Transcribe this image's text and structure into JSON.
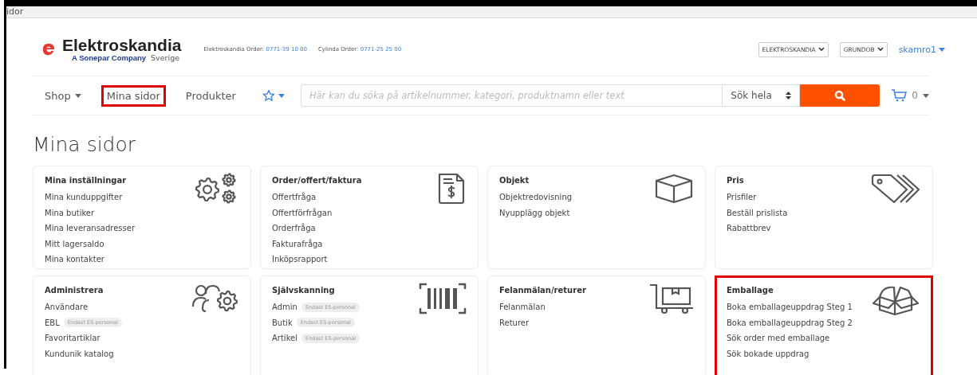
{
  "window": {
    "title": "idor"
  },
  "header": {
    "brand": "Elektroskandia",
    "tagline": "A Sonepar Company",
    "country": "Sverige",
    "contacts": [
      {
        "label": "Elektroskandia Order:",
        "phone": "0771-39 10 00"
      },
      {
        "label": "Cylinda Order:",
        "phone": "0771-25 25 00"
      }
    ],
    "selects": [
      "ELEKTROSKANDIA",
      "GRUNDOB"
    ],
    "user": "skamro1"
  },
  "nav": {
    "items": [
      {
        "label": "Shop",
        "dropdown": true,
        "highlighted": false
      },
      {
        "label": "Mina sidor",
        "dropdown": false,
        "highlighted": true
      },
      {
        "label": "Produkter",
        "dropdown": false,
        "highlighted": false
      }
    ],
    "search": {
      "placeholder": "Här kan du söka på artikelnummer, kategori, produktnamn eller text"
    },
    "scope": "Sök hela",
    "cart_count": "0"
  },
  "page_title": "Mina sidor",
  "cards": [
    {
      "title": "Mina inställningar",
      "kind": "gears",
      "highlighted": false,
      "items": [
        {
          "label": "Mina kunduppgifter"
        },
        {
          "label": "Mina butiker"
        },
        {
          "label": "Mina leveransadresser"
        },
        {
          "label": "Mitt lagersaldo"
        },
        {
          "label": "Mina kontakter"
        }
      ]
    },
    {
      "title": "Order/offert/faktura",
      "kind": "invoice",
      "highlighted": false,
      "items": [
        {
          "label": "Offertfråga"
        },
        {
          "label": "Offertförfrågan"
        },
        {
          "label": "Orderfråga"
        },
        {
          "label": "Fakturafråga"
        },
        {
          "label": "Inköpsrapport"
        }
      ]
    },
    {
      "title": "Objekt",
      "kind": "cube",
      "highlighted": false,
      "items": [
        {
          "label": "Objektredovisning"
        },
        {
          "label": "Nyupplägg objekt"
        }
      ]
    },
    {
      "title": "Pris",
      "kind": "tags",
      "highlighted": false,
      "items": [
        {
          "label": "Prisfiler"
        },
        {
          "label": "Beställ prislista"
        },
        {
          "label": "Rabattbrev"
        }
      ]
    },
    {
      "title": "Administrera",
      "kind": "users",
      "highlighted": false,
      "items": [
        {
          "label": "Användare"
        },
        {
          "label": "EBL",
          "badge": "Endast ES-personal"
        },
        {
          "label": "Favoritartiklar"
        },
        {
          "label": "Kundunik katalog"
        }
      ]
    },
    {
      "title": "Självskanning",
      "kind": "barcode",
      "highlighted": false,
      "items": [
        {
          "label": "Admin",
          "badge": "Endast ES-personal"
        },
        {
          "label": "Butik",
          "badge": "Endast ES-personal"
        },
        {
          "label": "Artikel",
          "badge": "Endast ES-personal"
        }
      ]
    },
    {
      "title": "Felanmälan/returer",
      "kind": "cart",
      "highlighted": false,
      "items": [
        {
          "label": "Felanmälan"
        },
        {
          "label": "Returer"
        }
      ]
    },
    {
      "title": "Emballage",
      "kind": "box",
      "highlighted": true,
      "items": [
        {
          "label": "Boka emballageuppdrag Steg 1"
        },
        {
          "label": "Boka emballageuppdrag Steg 2"
        },
        {
          "label": "Sök order med emballage"
        },
        {
          "label": "Sök bokade uppdrag"
        }
      ]
    }
  ]
}
